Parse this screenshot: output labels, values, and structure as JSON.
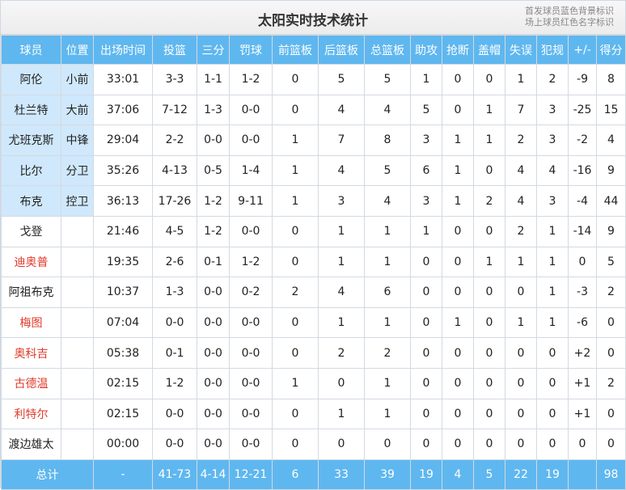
{
  "title": "太阳实时技术统计",
  "notes": [
    "首发球员蓝色背景标识",
    "场上球员红色名字标识"
  ],
  "columns": [
    "球员",
    "位置",
    "出场时间",
    "投篮",
    "三分",
    "罚球",
    "前篮板",
    "后篮板",
    "总篮板",
    "助攻",
    "抢断",
    "盖帽",
    "失误",
    "犯规",
    "+/-",
    "得分"
  ],
  "colors": {
    "header_bg": "#5fb7ef",
    "starter_bg": "#cfe8fb",
    "oncourt_text": "#e03a2a"
  },
  "rows": [
    {
      "starter": true,
      "oncourt": false,
      "cells": [
        "阿伦",
        "小前",
        "33:01",
        "3-3",
        "1-1",
        "1-2",
        "0",
        "5",
        "5",
        "1",
        "0",
        "0",
        "1",
        "2",
        "-9",
        "8"
      ]
    },
    {
      "starter": true,
      "oncourt": false,
      "cells": [
        "杜兰特",
        "大前",
        "37:06",
        "7-12",
        "1-3",
        "0-0",
        "0",
        "4",
        "4",
        "5",
        "0",
        "1",
        "7",
        "3",
        "-25",
        "15"
      ]
    },
    {
      "starter": true,
      "oncourt": false,
      "cells": [
        "尤班克斯",
        "中锋",
        "29:04",
        "2-2",
        "0-0",
        "0-0",
        "1",
        "7",
        "8",
        "3",
        "1",
        "1",
        "2",
        "3",
        "-2",
        "4"
      ]
    },
    {
      "starter": true,
      "oncourt": false,
      "cells": [
        "比尔",
        "分卫",
        "35:26",
        "4-13",
        "0-5",
        "1-4",
        "1",
        "4",
        "5",
        "6",
        "1",
        "0",
        "4",
        "4",
        "-16",
        "9"
      ]
    },
    {
      "starter": true,
      "oncourt": false,
      "cells": [
        "布克",
        "控卫",
        "36:13",
        "17-26",
        "1-2",
        "9-11",
        "1",
        "3",
        "4",
        "3",
        "1",
        "2",
        "4",
        "3",
        "-4",
        "44"
      ]
    },
    {
      "starter": false,
      "oncourt": false,
      "cells": [
        "戈登",
        "",
        "21:46",
        "4-5",
        "1-2",
        "0-0",
        "0",
        "1",
        "1",
        "1",
        "0",
        "0",
        "2",
        "1",
        "-14",
        "9"
      ]
    },
    {
      "starter": false,
      "oncourt": true,
      "cells": [
        "迪奥普",
        "",
        "19:35",
        "2-6",
        "0-1",
        "1-2",
        "0",
        "1",
        "1",
        "0",
        "0",
        "1",
        "1",
        "1",
        "0",
        "5"
      ]
    },
    {
      "starter": false,
      "oncourt": false,
      "cells": [
        "阿祖布克",
        "",
        "10:37",
        "1-3",
        "0-0",
        "0-2",
        "2",
        "4",
        "6",
        "0",
        "0",
        "0",
        "0",
        "1",
        "-3",
        "2"
      ]
    },
    {
      "starter": false,
      "oncourt": true,
      "cells": [
        "梅图",
        "",
        "07:04",
        "0-0",
        "0-0",
        "0-0",
        "0",
        "1",
        "1",
        "0",
        "1",
        "0",
        "1",
        "1",
        "-6",
        "0"
      ]
    },
    {
      "starter": false,
      "oncourt": true,
      "cells": [
        "奥科吉",
        "",
        "05:38",
        "0-1",
        "0-0",
        "0-0",
        "0",
        "2",
        "2",
        "0",
        "0",
        "0",
        "0",
        "0",
        "+2",
        "0"
      ]
    },
    {
      "starter": false,
      "oncourt": true,
      "cells": [
        "古德温",
        "",
        "02:15",
        "1-2",
        "0-0",
        "0-0",
        "1",
        "0",
        "1",
        "0",
        "0",
        "0",
        "0",
        "0",
        "+1",
        "2"
      ]
    },
    {
      "starter": false,
      "oncourt": true,
      "cells": [
        "利特尔",
        "",
        "02:15",
        "0-0",
        "0-0",
        "0-0",
        "0",
        "1",
        "1",
        "0",
        "0",
        "0",
        "0",
        "0",
        "+1",
        "0"
      ]
    },
    {
      "starter": false,
      "oncourt": false,
      "cells": [
        "渡边雄太",
        "",
        "00:00",
        "0-0",
        "0-0",
        "0-0",
        "0",
        "0",
        "0",
        "0",
        "0",
        "0",
        "0",
        "0",
        "0",
        "0"
      ]
    }
  ],
  "totals": [
    "总计",
    "-",
    "41-73",
    "4-14",
    "12-21",
    "6",
    "33",
    "39",
    "19",
    "4",
    "5",
    "22",
    "19",
    "",
    "98"
  ]
}
